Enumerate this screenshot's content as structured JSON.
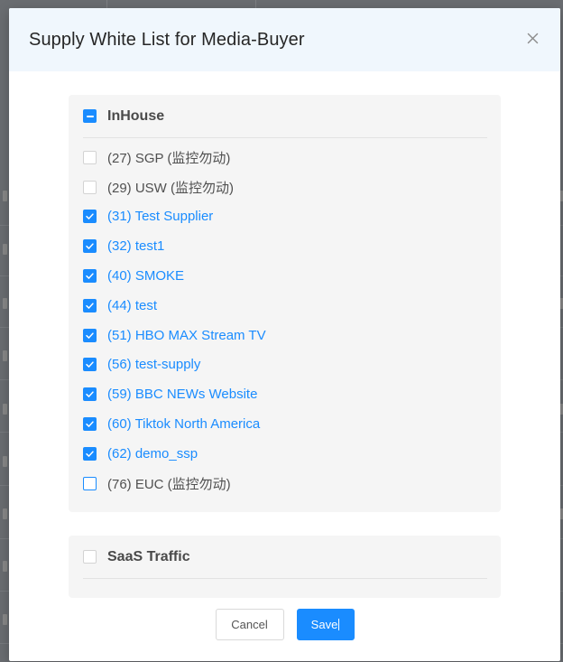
{
  "modal": {
    "title": "Supply White List for Media-Buyer",
    "close_icon": "close-icon"
  },
  "groups": {
    "inhouse": {
      "label": "InHouse",
      "state": "indeterminate",
      "items": [
        {
          "label": "(27) SGP (监控勿动)",
          "checked": false
        },
        {
          "label": "(29) USW (监控勿动)",
          "checked": false
        },
        {
          "label": "(31) Test Supplier",
          "checked": true
        },
        {
          "label": "(32) test1",
          "checked": true
        },
        {
          "label": "(40) SMOKE",
          "checked": true
        },
        {
          "label": "(44) test",
          "checked": true
        },
        {
          "label": "(51) HBO MAX Stream TV",
          "checked": true
        },
        {
          "label": "(56) test-supply",
          "checked": true
        },
        {
          "label": "(59) BBC NEWs Website",
          "checked": true
        },
        {
          "label": "(60) Tiktok North America",
          "checked": true
        },
        {
          "label": "(62) demo_ssp",
          "checked": true
        },
        {
          "label": "(76) EUC (监控勿动)",
          "checked": false
        }
      ]
    },
    "saas": {
      "label": "SaaS Traffic",
      "state": "unchecked"
    }
  },
  "footer": {
    "cancel_label": "Cancel",
    "save_label": "Save"
  },
  "colors": {
    "accent": "#1a8cff",
    "header_bg": "#f0f7fd",
    "group_bg": "#f5f5f5"
  }
}
